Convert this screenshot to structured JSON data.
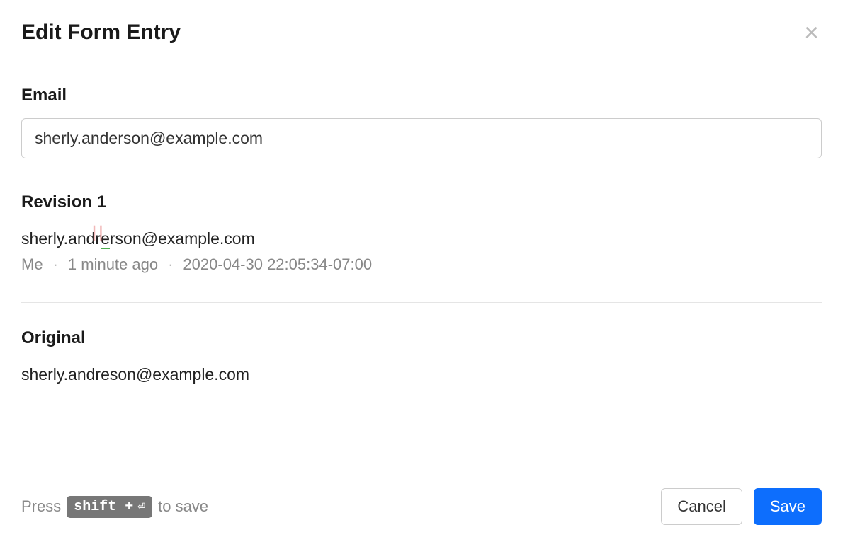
{
  "modal": {
    "title": "Edit Form Entry"
  },
  "field": {
    "label": "Email",
    "value": "sherly.anderson@example.com"
  },
  "revision": {
    "title": "Revision 1",
    "value_prefix": "sherly.and",
    "value_diff_char": "r",
    "value_diff_after": "e",
    "value_suffix": "rson@example.com",
    "meta": {
      "author": "Me",
      "relative": "1 minute ago",
      "timestamp": "2020-04-30 22:05:34-07:00"
    }
  },
  "original": {
    "title": "Original",
    "value": "sherly.andreson@example.com"
  },
  "footer": {
    "hint_prefix": "Press",
    "hint_key": "shift +",
    "hint_suffix": "to save",
    "cancel": "Cancel",
    "save": "Save"
  }
}
